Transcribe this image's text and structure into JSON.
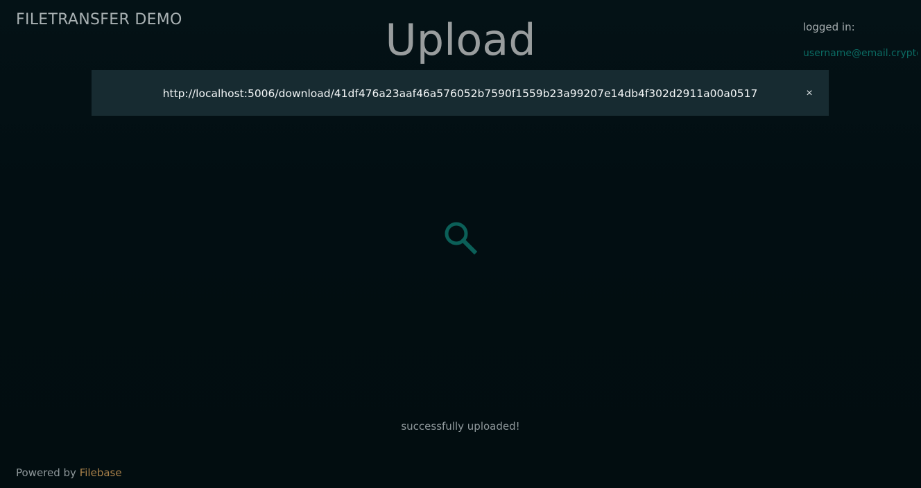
{
  "header": {
    "brand": "FILETRANSFER DEMO",
    "title": "Upload"
  },
  "auth": {
    "label": "logged in:",
    "user": "username@email.crypto"
  },
  "banner": {
    "url": "http://localhost:5006/download/41df476a23aaf46a576052b7590f1559b23a99207e14db4f302d2911a00a0517",
    "close_glyph": "×"
  },
  "upload": {
    "icon": "search-icon"
  },
  "status": {
    "message": "successfully uploaded!"
  },
  "footer": {
    "prefix": "Powered by",
    "link": "Filebase"
  },
  "colors": {
    "background": "#020f13",
    "banner": "#172b31",
    "accent": "#0b6b63",
    "link": "#a9814a"
  }
}
